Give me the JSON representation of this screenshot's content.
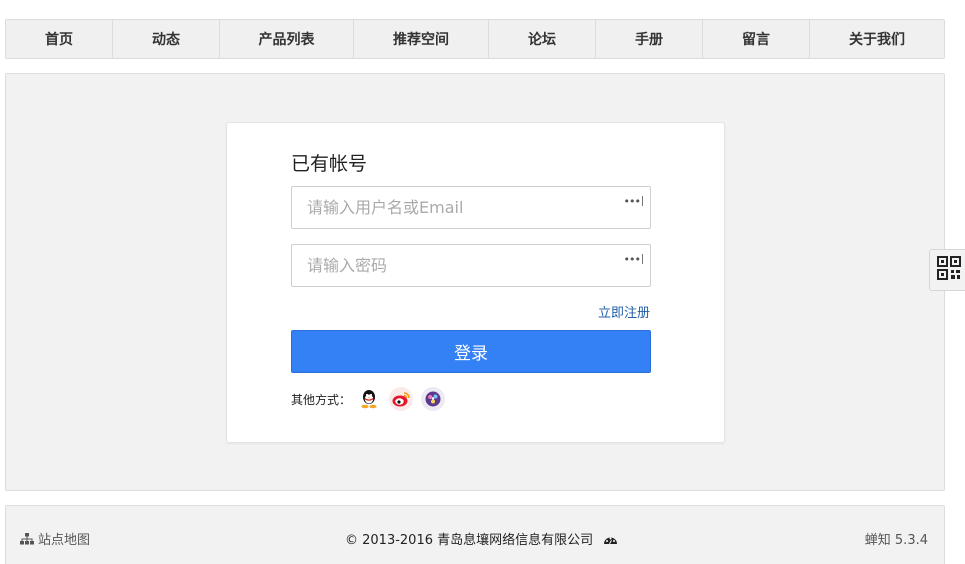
{
  "nav": {
    "items": [
      {
        "label": "首页"
      },
      {
        "label": "动态"
      },
      {
        "label": "产品列表"
      },
      {
        "label": "推荐空间"
      },
      {
        "label": "论坛"
      },
      {
        "label": "手册"
      },
      {
        "label": "留言"
      },
      {
        "label": "关于我们"
      }
    ]
  },
  "login": {
    "title": "已有帐号",
    "username_placeholder": "请输入用户名或Email",
    "password_placeholder": "请输入密码",
    "key_icon_text": "•••",
    "register_link": "立即注册",
    "submit_label": "登录",
    "other_methods_label": "其他方式：",
    "social_icons": [
      "qq-icon",
      "weibo-icon",
      "third-party-icon"
    ]
  },
  "sidebar_tab": {
    "icon": "qrcode-icon"
  },
  "footer": {
    "sitemap_label": "站点地图",
    "copyright": "© 2013-2016 青岛息壤网络信息有限公司",
    "version": "蝉知 5.3.4"
  },
  "colors": {
    "primary_button": "#3480f5",
    "link": "#1f5fa8",
    "background_panel": "#f2f2f2"
  }
}
